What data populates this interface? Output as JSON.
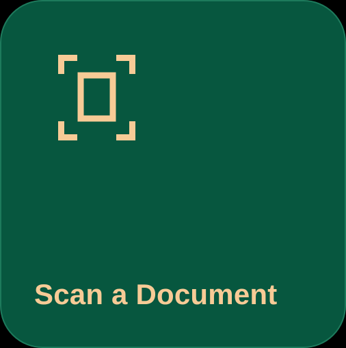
{
  "tile": {
    "label": "Scan a Document",
    "icon": "document-scan-icon"
  },
  "colors": {
    "background": "#000000",
    "tile": "#07573f",
    "accent": "#f7cb96"
  }
}
